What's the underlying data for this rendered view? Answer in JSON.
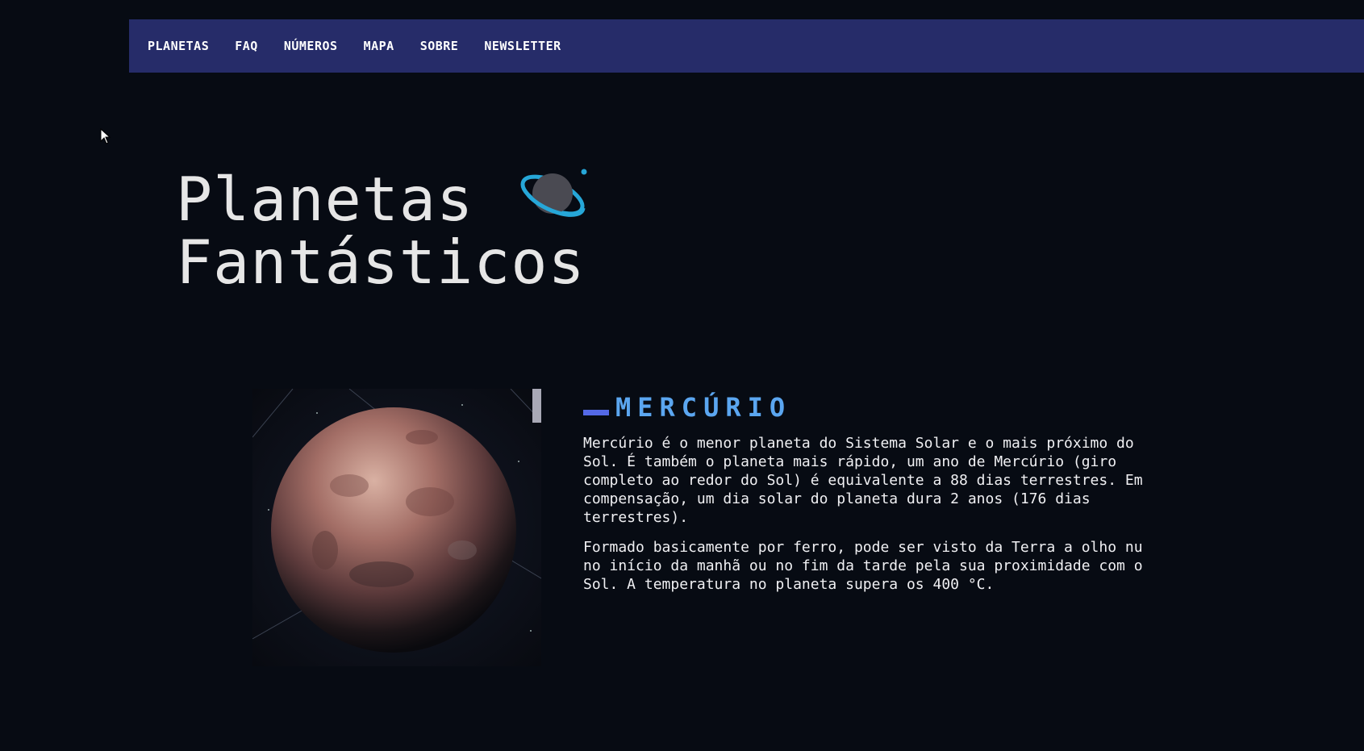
{
  "nav": {
    "items": [
      "PLANETAS",
      "FAQ",
      "NÚMEROS",
      "MAPA",
      "SOBRE",
      "NEWSLETTER"
    ]
  },
  "hero": {
    "title_line1": "Planetas",
    "title_line2": "Fantásticos",
    "logo_icon": "ringed-planet-icon"
  },
  "planet": {
    "name": "MERCÚRIO",
    "paragraphs": [
      "Mercúrio é o menor planeta do Sistema Solar e o mais próximo do Sol. É também o planeta mais rápido, um ano de Mercúrio (giro completo ao redor do Sol) é equivalente a 88 dias terrestres. Em compensação, um dia solar do planeta dura 2 anos (176 dias terrestres).",
      "Formado basicamente por ferro, pode ser visto da Terra a olho nu no início da manhã ou no fim da tarde pela sua proximidade com o Sol. A temperatura no planeta supera os 400 °C."
    ]
  },
  "colors": {
    "background": "#070b13",
    "nav_background": "#262c69",
    "heading_accent": "#5ba6f0",
    "heading_bar": "#5469e6",
    "logo_ring": "#26a7d8"
  }
}
